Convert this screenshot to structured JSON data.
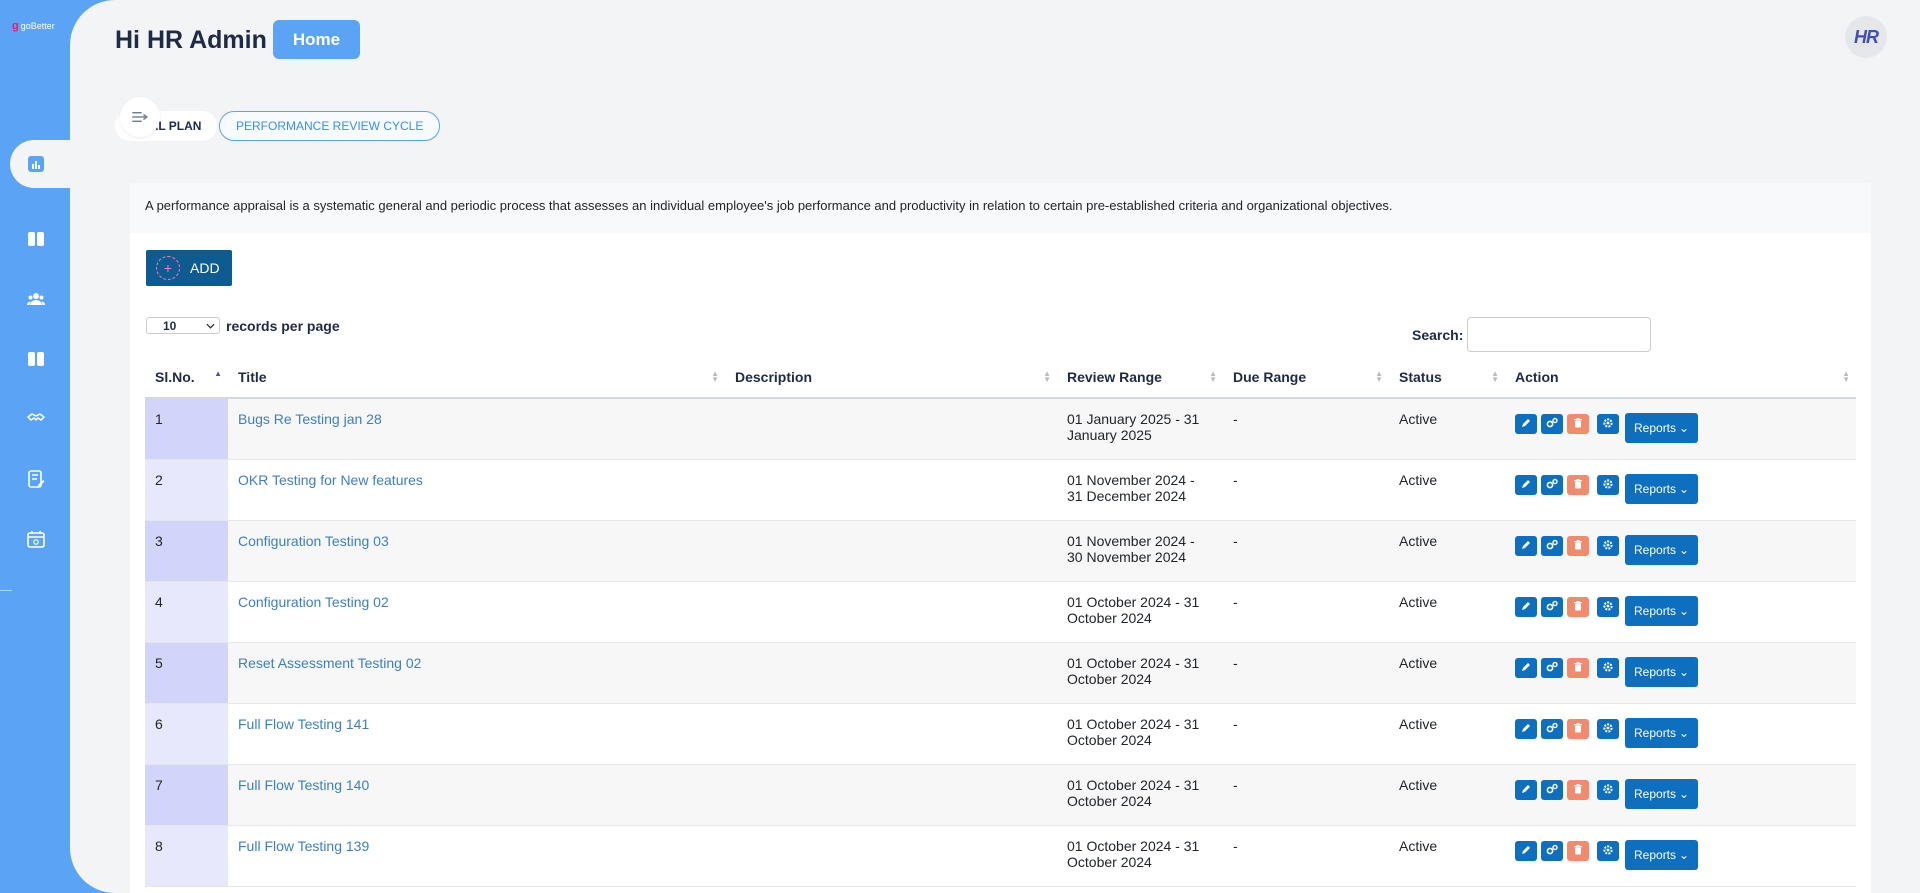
{
  "app": {
    "logo_text": "goBetter"
  },
  "header": {
    "greeting": "Hi HR Admin",
    "home_label": "Home",
    "avatar_initials": "HR"
  },
  "tabs": [
    {
      "label": "GOAL PLAN"
    },
    {
      "label": "PERFORMANCE REVIEW CYCLE"
    }
  ],
  "description": "A performance appraisal is a systematic general and periodic process that assesses an individual employee's job performance and productivity in relation to certain pre-established criteria and organizational objectives.",
  "add_label": "ADD",
  "page_size": {
    "value": "10",
    "suffix": "records per page"
  },
  "search": {
    "label": "Search:",
    "value": ""
  },
  "table": {
    "headers": [
      "Sl.No.",
      "Title",
      "Description",
      "Review Range",
      "Due Range",
      "Status",
      "Action"
    ],
    "reports_label": "Reports",
    "rows": [
      {
        "sl": "1",
        "title": "Bugs Re Testing jan 28",
        "description": "",
        "review_range": "01 January 2025 - 31 January 2025",
        "due_range": "-",
        "status": "Active"
      },
      {
        "sl": "2",
        "title": "OKR Testing for New features",
        "description": "",
        "review_range": "01 November 2024 - 31 December 2024",
        "due_range": "-",
        "status": "Active"
      },
      {
        "sl": "3",
        "title": "Configuration Testing 03",
        "description": "",
        "review_range": "01 November 2024 - 30 November 2024",
        "due_range": "-",
        "status": "Active"
      },
      {
        "sl": "4",
        "title": "Configuration Testing 02",
        "description": "",
        "review_range": "01 October 2024 - 31 October 2024",
        "due_range": "-",
        "status": "Active"
      },
      {
        "sl": "5",
        "title": "Reset Assessment Testing 02",
        "description": "",
        "review_range": "01 October 2024 - 31 October 2024",
        "due_range": "-",
        "status": "Active"
      },
      {
        "sl": "6",
        "title": "Full Flow Testing 141",
        "description": "",
        "review_range": "01 October 2024 - 31 October 2024",
        "due_range": "-",
        "status": "Active"
      },
      {
        "sl": "7",
        "title": "Full Flow Testing 140",
        "description": "",
        "review_range": "01 October 2024 - 31 October 2024",
        "due_range": "-",
        "status": "Active"
      },
      {
        "sl": "8",
        "title": "Full Flow Testing 139",
        "description": "",
        "review_range": "01 October 2024 - 31 October 2024",
        "due_range": "-",
        "status": "Active"
      }
    ]
  },
  "sidebar": {
    "icons": [
      "dashboard-icon",
      "columns-icon",
      "users-icon",
      "columns-icon",
      "handshake-icon",
      "notes-icon",
      "calendar-icon"
    ]
  },
  "colors": {
    "primary": "#5aa3f5",
    "action_blue": "#0e6fbf",
    "delete_orange": "#f28b6e",
    "add_button": "#0e5b92"
  }
}
